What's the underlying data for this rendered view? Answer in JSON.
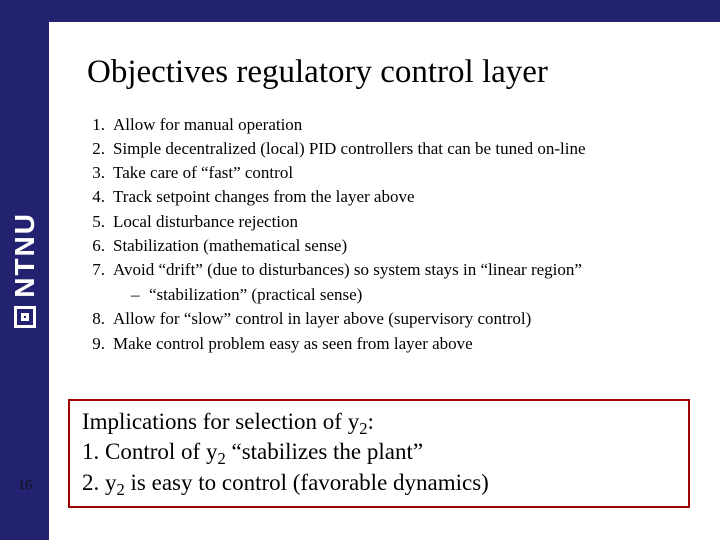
{
  "page_number": "16",
  "sidebar": {
    "logotype": "NTNU"
  },
  "title": "Objectives regulatory control layer",
  "objectives": {
    "items": [
      {
        "n": "1.",
        "text": "Allow for manual operation"
      },
      {
        "n": "2.",
        "text": "Simple decentralized (local) PID controllers that can be tuned on-line"
      },
      {
        "n": "3.",
        "text": "Take care of “fast” control"
      },
      {
        "n": "4.",
        "text": "Track setpoint changes from the layer above"
      },
      {
        "n": "5.",
        "text": "Local disturbance rejection"
      },
      {
        "n": "6.",
        "text": "Stabilization (mathematical sense)"
      },
      {
        "n": "7.",
        "text": "Avoid “drift”  (due to disturbances) so system stays in “linear region”"
      }
    ],
    "sub_after_7": "“stabilization” (practical sense)",
    "items_tail": [
      {
        "n": "8.",
        "text": "Allow for “slow” control in layer above (supervisory control)"
      },
      {
        "n": "9.",
        "text": "Make control problem easy as seen from layer above"
      }
    ]
  },
  "box": {
    "line1_a": "Implications for selection of y",
    "line1_sub": "2",
    "line1_b": ":",
    "line2_a": "1.  Control of y",
    "line2_sub": "2",
    "line2_b": " “stabilizes the plant”",
    "line3_a": "2.  y",
    "line3_sub": "2",
    "line3_b": " is easy to control (favorable dynamics)"
  }
}
